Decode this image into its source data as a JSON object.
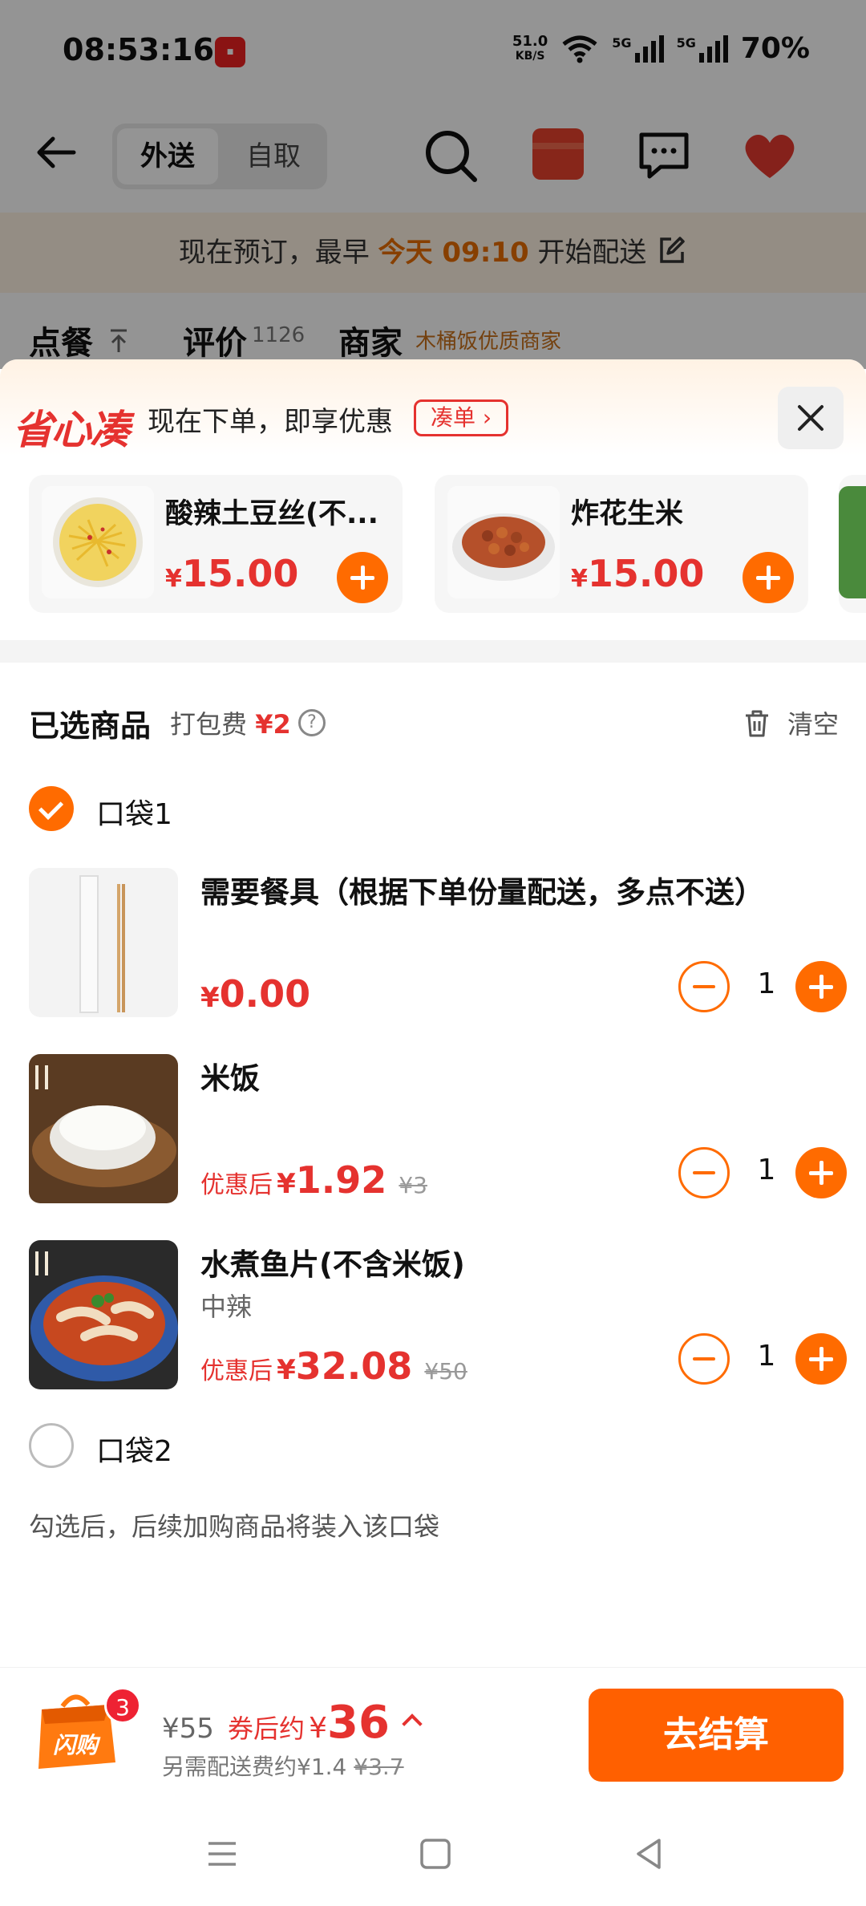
{
  "status_bar": {
    "time": "08:53:16",
    "net_speed": "51.0",
    "net_unit": "KB/S",
    "net_type_1": "5G",
    "net_type_2": "5G",
    "battery": "70%"
  },
  "header": {
    "tab_delivery": "外送",
    "tab_pickup": "自取",
    "icons": [
      "back-arrow-icon",
      "search-icon",
      "red-packet-icon",
      "message-icon",
      "heart-icon"
    ]
  },
  "notice": {
    "prefix": "现在预订，最早",
    "highlight": "今天 09:10",
    "suffix": "开始配送"
  },
  "store_tabs": {
    "order": "点餐",
    "reviews": "评价",
    "reviews_count": "1126",
    "merchant": "商家",
    "merchant_tag": "木桶饭优质商家"
  },
  "promo": {
    "logo": "省心凑",
    "text": "现在下单，即享优惠",
    "button": "凑单 ›",
    "products": [
      {
        "name": "酸辣土豆丝(不...",
        "currency": "¥",
        "price": "15.00"
      },
      {
        "name": "炸花生米",
        "currency": "¥",
        "price": "15.00"
      }
    ]
  },
  "cart": {
    "title": "已选商品",
    "packing_fee_label": "打包费",
    "packing_fee": "¥2",
    "help": "?",
    "clear": "清空",
    "bag1": "口袋1",
    "bag2": "口袋2",
    "items": [
      {
        "name": "需要餐具（根据下单份量配送，多点不送）",
        "spec": "",
        "prefix": "",
        "currency": "¥",
        "price": "0.00",
        "original": "",
        "qty": "1"
      },
      {
        "name": "米饭",
        "spec": "",
        "prefix": "优惠后",
        "currency": "¥",
        "price": "1.92",
        "original": "¥3",
        "qty": "1"
      },
      {
        "name": "水煮鱼片(不含米饭)",
        "spec": "中辣",
        "prefix": "优惠后",
        "currency": "¥",
        "price": "32.08",
        "original": "¥50",
        "qty": "1"
      }
    ],
    "hint": "勾选后，后续加购商品将装入该口袋"
  },
  "checkout": {
    "badge_count": "3",
    "bag_label": "闪购",
    "original_total": "¥55",
    "after_label": "券后约",
    "currency": "¥",
    "after_total": "36",
    "delivery_fee_label": "另需配送费约",
    "delivery_fee": "¥1.4",
    "delivery_fee_original": "¥3.7",
    "pay_button": "去结算"
  },
  "colors": {
    "accent_orange": "#ff6b00",
    "price_red": "#e5322f",
    "pay_button": "#ff6000"
  }
}
